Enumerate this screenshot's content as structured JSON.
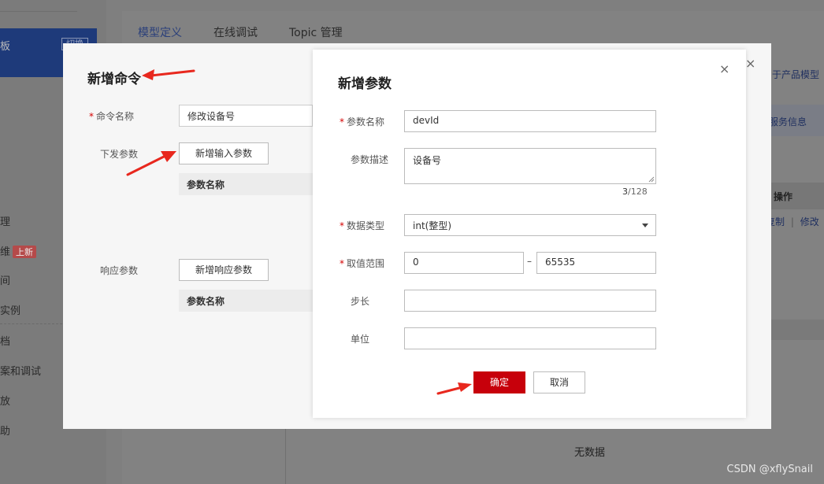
{
  "background": {
    "sidebar": {
      "active_item": "板",
      "switch_label": "切换",
      "items": [
        "理",
        "维",
        "间",
        "实例",
        "档",
        "案和调试",
        "放",
        "助"
      ],
      "new_badge": "上新"
    },
    "tabs": [
      {
        "label": "模型定义",
        "active": true
      },
      {
        "label": "在线调试",
        "active": false
      },
      {
        "label": "Topic 管理",
        "active": false
      }
    ],
    "right_link": "于产品模型",
    "right_tab": "服务信息",
    "col_header_ops": "操作",
    "row_actions": [
      "复制",
      "修改"
    ],
    "row_sep": "|",
    "empty_text": "无数据"
  },
  "dialog_command": {
    "title": "新增命令",
    "close_icon": "×",
    "command_name_label": "命令名称",
    "command_name_value": "修改设备号",
    "send_params_label": "下发参数",
    "add_input_param_button": "新增输入参数",
    "table_header_param_name": "参数名称",
    "response_params_label": "响应参数",
    "add_response_param_button": "新增响应参数",
    "table_header_param_name_2": "参数名称",
    "required_mark": "*"
  },
  "dialog_param": {
    "title": "新增参数",
    "close_icon": "×",
    "param_name_label": "参数名称",
    "param_name_value": "devId",
    "param_desc_label": "参数描述",
    "param_desc_value": "设备号",
    "desc_counter_current": "3",
    "desc_counter_max": "/128",
    "data_type_label": "数据类型",
    "data_type_value": "int(整型)",
    "range_label": "取值范围",
    "range_min": "0",
    "range_sep": "–",
    "range_max": "65535",
    "step_label": "步长",
    "step_value": "",
    "unit_label": "单位",
    "unit_value": "",
    "ok_button": "确定",
    "cancel_button": "取消",
    "required_mark": "*"
  },
  "watermark": "CSDN @xflySnail",
  "colors": {
    "primary_red": "#c7000b",
    "required_red": "#d40000",
    "annotation_arrow": "#e8281e"
  }
}
